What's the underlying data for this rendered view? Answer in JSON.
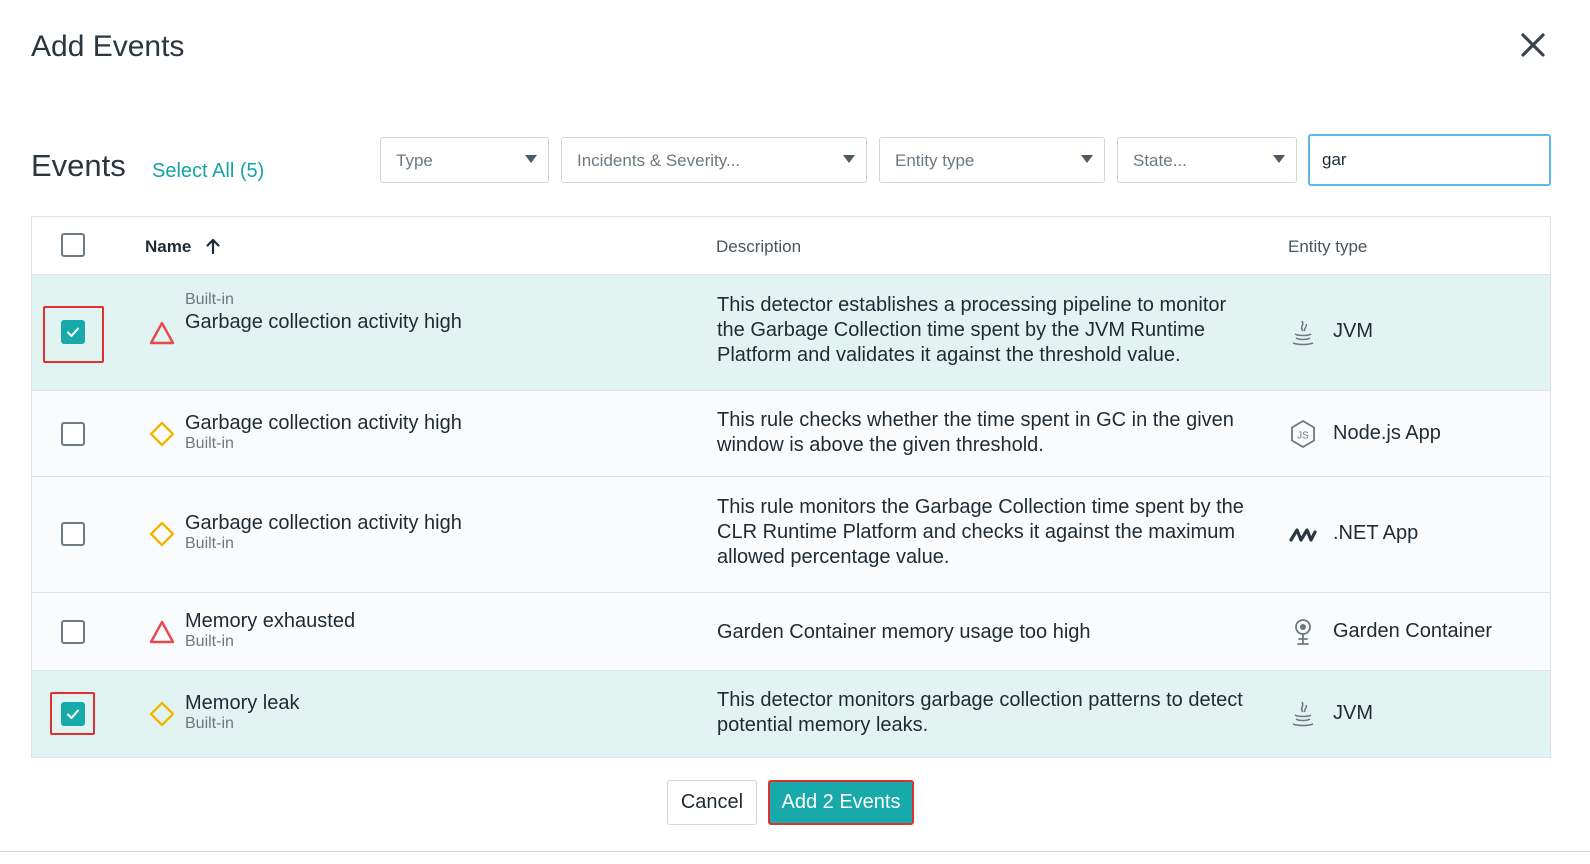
{
  "dialog": {
    "title": "Add Events"
  },
  "events": {
    "title": "Events",
    "select_all": "Select All (5)",
    "filters": {
      "type": "Type",
      "incidents": "Incidents & Severity...",
      "entity_type": "Entity type",
      "state": "State..."
    },
    "search_value": "gar"
  },
  "table": {
    "headers": {
      "name": "Name",
      "description": "Description",
      "entity_type": "Entity type"
    },
    "sort": "ascending",
    "rows": [
      {
        "selected": true,
        "severity": "critical-triangle-icon",
        "name": "Garbage collection activity high",
        "source": "Built-in",
        "description": "This detector establishes a processing pipeline to monitor the Garbage Collection time spent by the JVM Runtime Platform and validates it against the threshold value.",
        "entity_icon": "java-icon",
        "entity": "JVM"
      },
      {
        "selected": false,
        "severity": "warning-diamond-icon",
        "name": "Garbage collection activity high",
        "source": "Built-in",
        "description": "This rule checks whether the time spent in GC in the given window is above the given threshold.",
        "entity_icon": "nodejs-icon",
        "entity": "Node.js App"
      },
      {
        "selected": false,
        "severity": "warning-diamond-icon",
        "name": "Garbage collection activity high",
        "source": "Built-in",
        "description": "This rule monitors the Garbage Collection time spent by the CLR Runtime Platform and checks it against the maximum allowed percentage value.",
        "entity_icon": "dotnet-icon",
        "entity": ".NET App"
      },
      {
        "selected": false,
        "severity": "critical-triangle-icon",
        "name": "Memory exhausted",
        "source": "Built-in",
        "description": "Garden Container memory usage too high",
        "entity_icon": "garden-container-icon",
        "entity": "Garden Container"
      },
      {
        "selected": true,
        "severity": "warning-diamond-icon",
        "name": "Memory leak",
        "source": "Built-in",
        "description": "This detector monitors garbage collection patterns to detect potential memory leaks.",
        "entity_icon": "java-icon",
        "entity": "JVM"
      }
    ]
  },
  "footer": {
    "cancel": "Cancel",
    "add": "Add 2 Events"
  },
  "colors": {
    "accent": "#18a9ab",
    "critical": "#e5484d",
    "warning": "#f2b705",
    "selected_row": "#e1f4f2",
    "highlight": "#e03131"
  }
}
